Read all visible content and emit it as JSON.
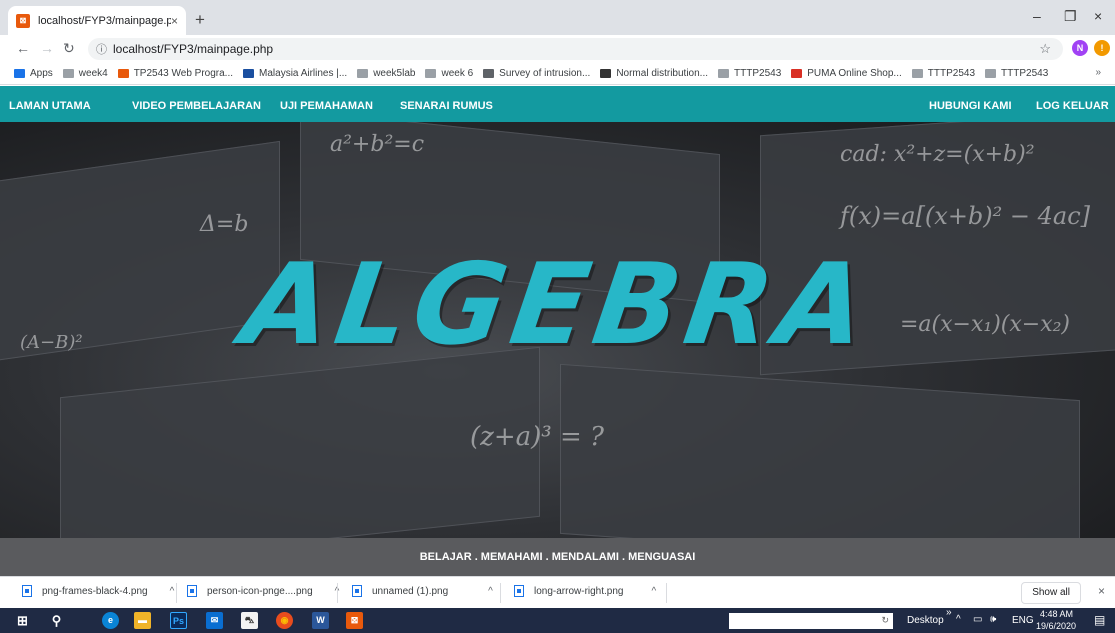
{
  "browser": {
    "tab_title": "localhost/FYP3/mainpage.php",
    "tab_close": "×",
    "new_tab": "+",
    "url_info_icon": "ⓘ",
    "url": "localhost/FYP3/mainpage.php",
    "profile_initial": "N",
    "update_initial": "!",
    "win_min": "–",
    "win_max": "❐",
    "win_close": "×"
  },
  "bookmarks": [
    {
      "label": "Apps",
      "color": "#1a73e8"
    },
    {
      "label": "week4",
      "color": "#9aa0a6"
    },
    {
      "label": "TP2543 Web Progra...",
      "color": "#e8590c"
    },
    {
      "label": "Malaysia Airlines |...",
      "color": "#1a4fa0"
    },
    {
      "label": "week5lab",
      "color": "#9aa0a6"
    },
    {
      "label": "week 6",
      "color": "#9aa0a6"
    },
    {
      "label": "Survey of intrusion...",
      "color": "#5f6368"
    },
    {
      "label": "Normal distribution...",
      "color": "#333333"
    },
    {
      "label": "TTTP2543",
      "color": "#9aa0a6"
    },
    {
      "label": "PUMA Online Shop...",
      "color": "#d93025"
    },
    {
      "label": "TTTP2543",
      "color": "#9aa0a6"
    },
    {
      "label": "TTTP2543",
      "color": "#9aa0a6"
    }
  ],
  "bookmarks_more": "»",
  "site": {
    "nav": {
      "home": "LAMAN UTAMA",
      "videos": "VIDEO PEMBELAJARAN",
      "quiz": "UJI PEMAHAMAN",
      "formulas": "SENARAI RUMUS",
      "contact": "HUBUNGI KAMI",
      "logout": "LOG KELUAR"
    },
    "hero_title": "ALGEBRA",
    "tagline": "BELAJAR . MEMAHAMI . MENDALAMI . MENGUASAI",
    "accent_color": "#27b7c8",
    "nav_color": "#139aa0"
  },
  "downloads": {
    "items": [
      "png-frames-black-4.png",
      "person-icon-pnge....png",
      "unnamed (1).png",
      "long-arrow-right.png"
    ],
    "chevron": "^",
    "show_all": "Show all",
    "close": "×"
  },
  "taskbar": {
    "desktop_label": "Desktop",
    "lang": "ENG",
    "time": "4:48 AM",
    "date": "19/6/2020"
  }
}
